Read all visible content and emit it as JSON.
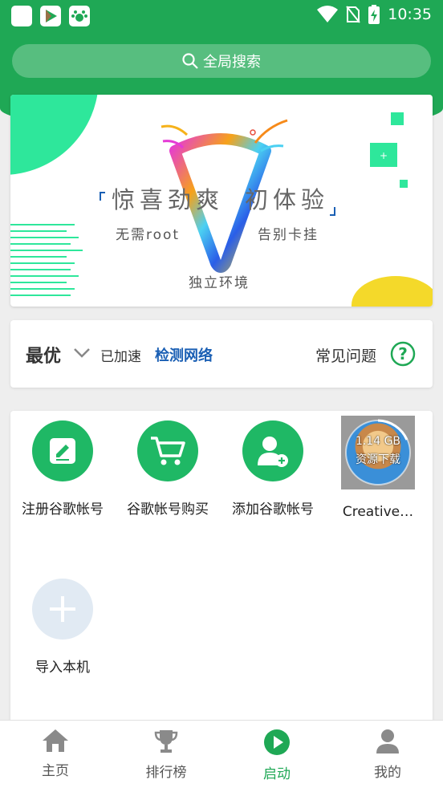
{
  "status": {
    "time": "10:35"
  },
  "search": {
    "label": "全局搜索"
  },
  "banner": {
    "headline_left": "惊喜劲爽",
    "headline_right": "初体验",
    "sub_left": "无需root",
    "sub_right": "告别卡挂",
    "sub_bottom": "独立环境"
  },
  "accel": {
    "mode": "最优",
    "status": "已加速",
    "detect": "检测网络",
    "faq": "常见问题"
  },
  "apps": [
    {
      "label": "注册谷歌帐号",
      "icon": "edit-icon"
    },
    {
      "label": "谷歌帐号购买",
      "icon": "cart-icon"
    },
    {
      "label": "添加谷歌帐号",
      "icon": "add-user-icon"
    },
    {
      "label": "Creative…",
      "icon": "game-thumbnail",
      "size": "1.14 GB",
      "progress_text": "资源下载"
    }
  ],
  "import": {
    "label": "导入本机"
  },
  "nav": [
    {
      "label": "主页",
      "icon": "home-icon"
    },
    {
      "label": "排行榜",
      "icon": "trophy-icon"
    },
    {
      "label": "启动",
      "icon": "play-icon",
      "active": true
    },
    {
      "label": "我的",
      "icon": "user-icon"
    }
  ],
  "colors": {
    "primary": "#1fa855",
    "accent_blue": "#1a5fb4",
    "app_green": "#1fb865"
  }
}
